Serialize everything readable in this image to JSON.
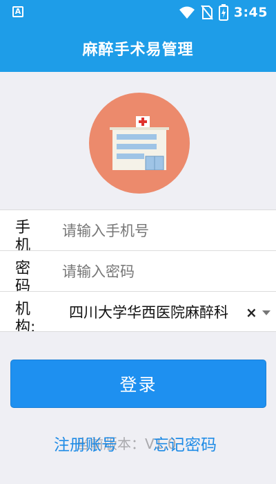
{
  "status_bar": {
    "time": "3:45",
    "app_indicator": "A",
    "icons": [
      "wifi-icon",
      "no-sim-icon",
      "battery-charging-icon"
    ]
  },
  "app_bar": {
    "title": "麻醉手术易管理"
  },
  "logo": {
    "icon": "hospital-icon",
    "background": "#ec8a6c"
  },
  "form": {
    "phone": {
      "label": "手机",
      "placeholder": "请输入手机号",
      "value": ""
    },
    "password": {
      "label": "密码",
      "placeholder": "请输入密码",
      "value": ""
    },
    "institution": {
      "label": "机构:",
      "value": "四川大学华西医院麻醉科",
      "clear_icon": "×"
    }
  },
  "login_button": {
    "label": "登录"
  },
  "bottom": {
    "version_label": "当前版本：V1.0",
    "register_link": "注册账号",
    "forgot_link": "忘记密码"
  },
  "colors": {
    "primary": "#1e9de8",
    "button": "#1e90f0",
    "link": "#1e8be6",
    "background": "#efeff4"
  }
}
